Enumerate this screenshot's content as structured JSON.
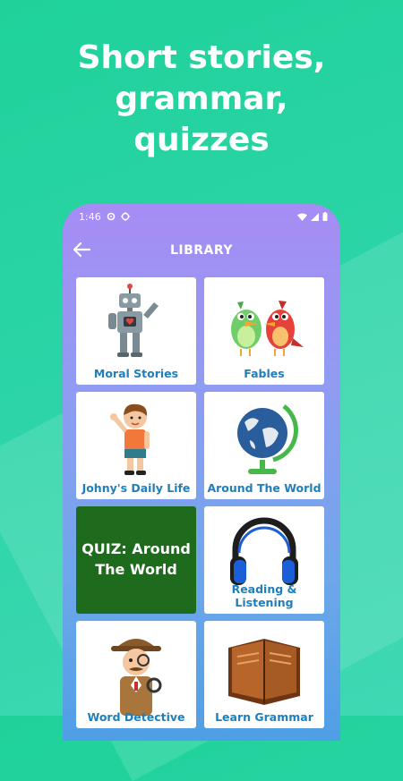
{
  "headline": [
    "Short stories,",
    "grammar,",
    "quizzes"
  ],
  "status_bar": {
    "time": "1:46"
  },
  "app_bar": {
    "title": "LIBRARY"
  },
  "cards": [
    {
      "label": "Moral Stories",
      "icon": "robot-icon"
    },
    {
      "label": "Fables",
      "icon": "birds-icon"
    },
    {
      "label": "Johny's Daily Life",
      "icon": "boy-icon"
    },
    {
      "label": "Around The World",
      "icon": "globe-icon"
    },
    {
      "label": "QUIZ: Around The World",
      "icon": "",
      "lines": [
        "QUIZ: Around",
        "The World"
      ]
    },
    {
      "label": "Reading & Listening",
      "icon": "headphones-icon"
    },
    {
      "label": "Word Detective",
      "icon": "detective-icon"
    },
    {
      "label": "Learn Grammar",
      "icon": "book-icon"
    }
  ],
  "colors": {
    "accent": "#1e7fbd",
    "quiz_bg": "#1e6b1e",
    "background": "#25d3a0"
  }
}
